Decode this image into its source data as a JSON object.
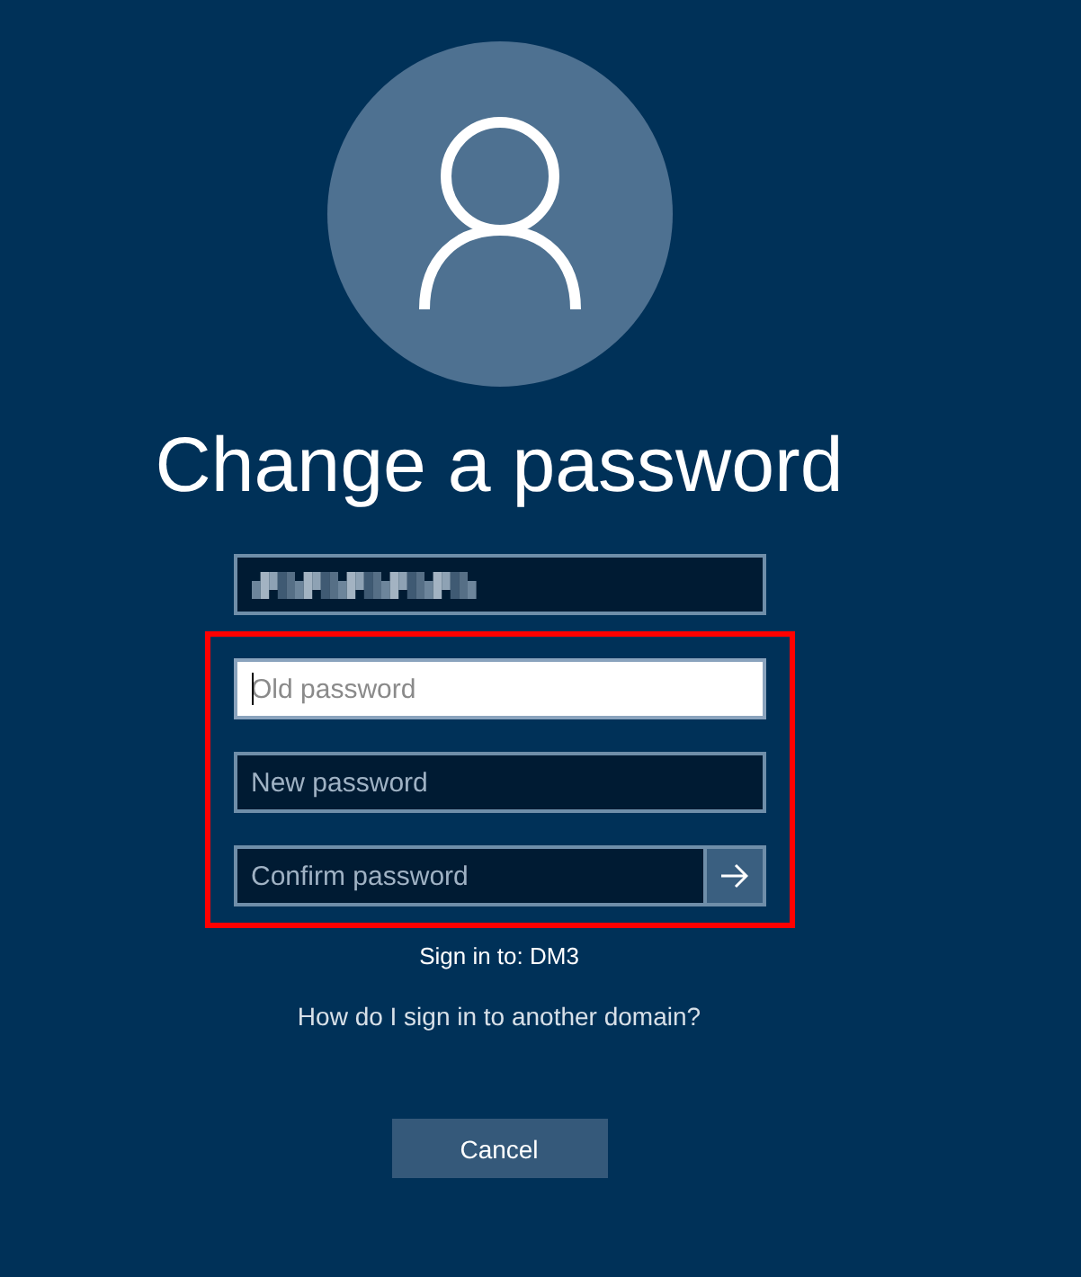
{
  "title": "Change a password",
  "account": {
    "kind": "obscured"
  },
  "password_fields": [
    {
      "placeholder": "Old password",
      "focused": true,
      "submit": false
    },
    {
      "placeholder": "New password",
      "focused": false,
      "submit": false
    },
    {
      "placeholder": "Confirm password",
      "focused": false,
      "submit": true
    }
  ],
  "sign_in_to": "Sign in to: DM3",
  "help_link": "How do I sign in to another domain?",
  "buttons": [
    "Cancel"
  ]
}
